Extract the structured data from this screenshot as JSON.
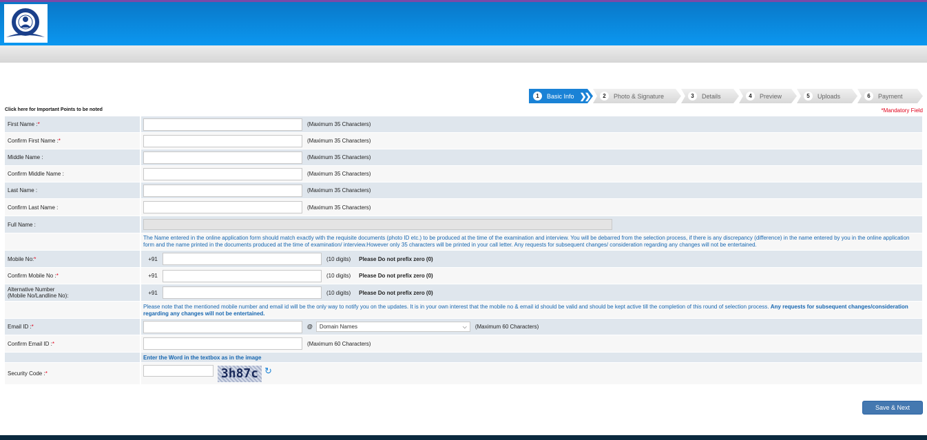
{
  "header": {
    "logo": "organization-seal-logo"
  },
  "steps": [
    {
      "n": "1",
      "label": "Basic Info"
    },
    {
      "n": "2",
      "label": "Photo & Signature"
    },
    {
      "n": "3",
      "label": "Details"
    },
    {
      "n": "4",
      "label": "Preview"
    },
    {
      "n": "5",
      "label": "Uploads"
    },
    {
      "n": "6",
      "label": "Payment"
    }
  ],
  "important_link": "Click here for Important Points to be noted",
  "mandatory": "*Mandatory Field",
  "fields": {
    "first_name": "First Name : ",
    "confirm_first_name": "Confirm First Name : ",
    "middle_name": "Middle Name :",
    "confirm_middle_name": "Confirm Middle Name :",
    "last_name": "Last Name :",
    "confirm_last_name": "Confirm Last Name :",
    "full_name": "Full Name :",
    "mobile": "Mobile No:",
    "confirm_mobile": "Confirm Mobile No :",
    "alt_number": "Alternative Number",
    "alt_number_sub": "(Mobile No/Landline No):",
    "email": "Email ID :",
    "confirm_email": "Confirm Email ID : ",
    "security": "Security Code :"
  },
  "star": "*",
  "hints": {
    "max35": "(Maximum 35 Characters)",
    "max60": "(Maximum 60 Characters)",
    "digits": "(10 digits)",
    "no_zero": "Please Do not prefix zero (0)",
    "prefix": "+91",
    "at": "@"
  },
  "name_note": "The Name entered in the online application form should match exactly with the requisite documents (photo ID etc.) to be produced at the time of the examination and interview. You will be debarred from the selection process, if there is any discrepancy (difference) in the name entered by you in the online application form and the name printed in the documents produced at the time of examination/ interview.However only 35 characters will be printed in your call letter. Any requests for subsequent changes/ consideration regarding any changes will not be entertained.",
  "contact_note": "Please note that the mentioned mobile number and email id will be the only way to notify you on the updates. It is in your own interest that the mobile no & email id should be valid and should be kept active till the completion of this round of selection process. ",
  "contact_note_bold": "Any requests for subsequent changes/consideration regarding any changes will not be entertained.",
  "domain_select": {
    "selected": "Domain Names"
  },
  "captcha_hint": "Enter the Word in the textbox as in the image",
  "captcha_text": "3h87c",
  "save_label": "Save & Next"
}
